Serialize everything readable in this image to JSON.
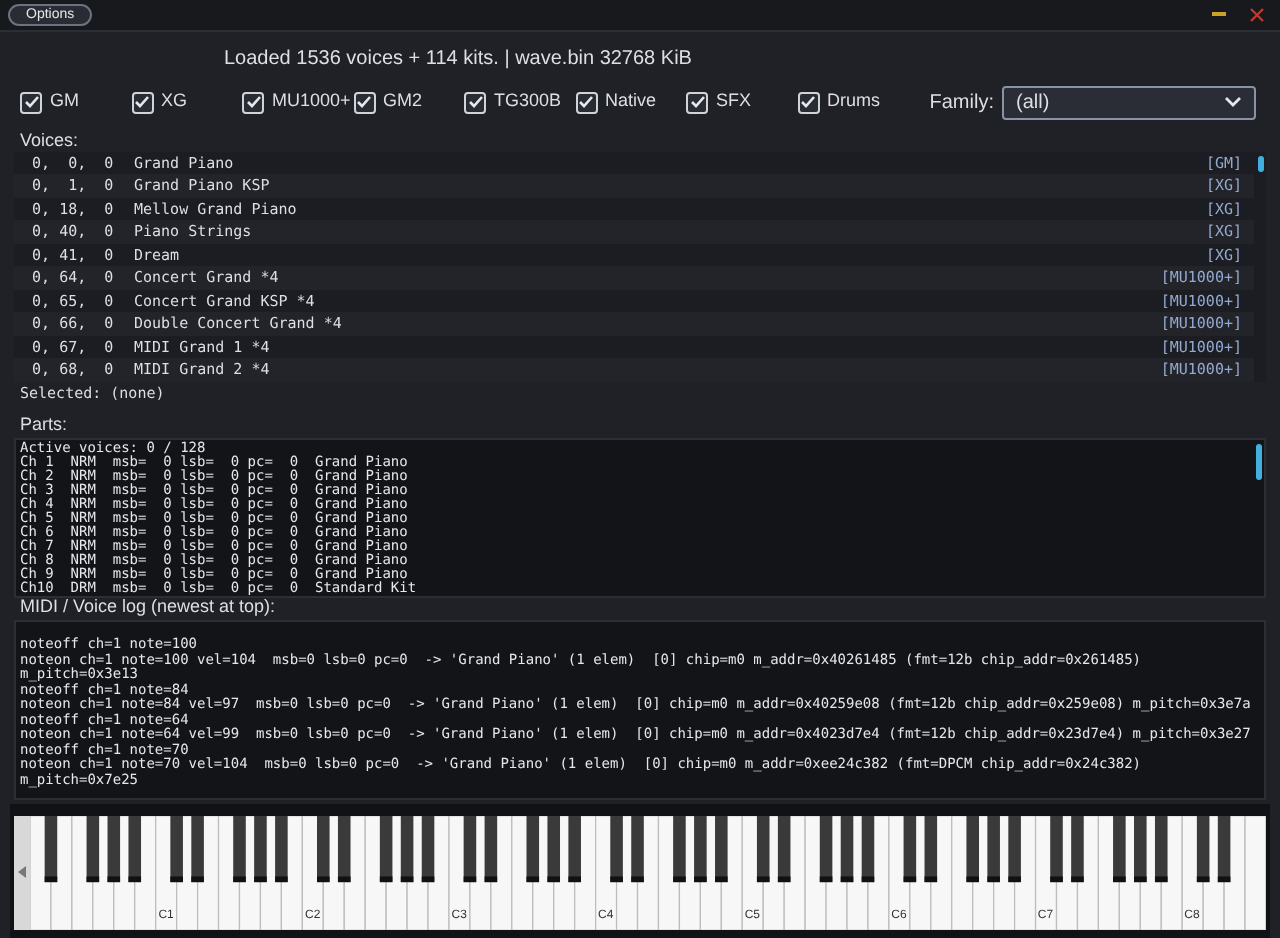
{
  "title_bar": {
    "options_button": "Options"
  },
  "status": "Loaded 1536 voices + 114 kits. | wave.bin 32768 KiB",
  "filters": [
    {
      "label": "GM",
      "checked": true
    },
    {
      "label": "XG",
      "checked": true
    },
    {
      "label": "MU1000+",
      "checked": true
    },
    {
      "label": "GM2",
      "checked": true
    },
    {
      "label": "TG300B",
      "checked": true
    },
    {
      "label": "Native",
      "checked": true
    },
    {
      "label": "SFX",
      "checked": true
    },
    {
      "label": "Drums",
      "checked": true
    }
  ],
  "family": {
    "label": "Family:",
    "value": "(all)"
  },
  "voices": {
    "label": "Voices:",
    "rows": [
      {
        "bank": "  0,  0,  0",
        "name": "Grand Piano",
        "tag": "[GM]"
      },
      {
        "bank": "  0,  1,  0",
        "name": "Grand Piano KSP",
        "tag": "[XG]"
      },
      {
        "bank": "  0, 18,  0",
        "name": "Mellow Grand Piano",
        "tag": "[XG]"
      },
      {
        "bank": "  0, 40,  0",
        "name": "Piano Strings",
        "tag": "[XG]"
      },
      {
        "bank": "  0, 41,  0",
        "name": "Dream",
        "tag": "[XG]"
      },
      {
        "bank": "  0, 64,  0",
        "name": "Concert Grand *4",
        "tag": "[MU1000+]"
      },
      {
        "bank": "  0, 65,  0",
        "name": "Concert Grand KSP *4",
        "tag": "[MU1000+]"
      },
      {
        "bank": "  0, 66,  0",
        "name": "Double Concert Grand *4",
        "tag": "[MU1000+]"
      },
      {
        "bank": "  0, 67,  0",
        "name": "MIDI Grand 1 *4",
        "tag": "[MU1000+]"
      },
      {
        "bank": "  0, 68,  0",
        "name": "MIDI Grand 2 *4",
        "tag": "[MU1000+]"
      }
    ],
    "selected": "Selected: (none)"
  },
  "parts": {
    "label": "Parts:",
    "lines": [
      "Active voices: 0 / 128",
      "Ch 1  NRM  msb=  0 lsb=  0 pc=  0  Grand Piano",
      "Ch 2  NRM  msb=  0 lsb=  0 pc=  0  Grand Piano",
      "Ch 3  NRM  msb=  0 lsb=  0 pc=  0  Grand Piano",
      "Ch 4  NRM  msb=  0 lsb=  0 pc=  0  Grand Piano",
      "Ch 5  NRM  msb=  0 lsb=  0 pc=  0  Grand Piano",
      "Ch 6  NRM  msb=  0 lsb=  0 pc=  0  Grand Piano",
      "Ch 7  NRM  msb=  0 lsb=  0 pc=  0  Grand Piano",
      "Ch 8  NRM  msb=  0 lsb=  0 pc=  0  Grand Piano",
      "Ch 9  NRM  msb=  0 lsb=  0 pc=  0  Grand Piano",
      "Ch10  DRM  msb=  0 lsb=  0 pc=  0  Standard Kit"
    ]
  },
  "log": {
    "label": "MIDI / Voice log (newest at top):",
    "lines": [
      "noteoff ch=1 note=100",
      "noteon ch=1 note=100 vel=104  msb=0 lsb=0 pc=0  -> 'Grand Piano' (1 elem)  [0] chip=m0 m_addr=0x40261485 (fmt=12b chip_addr=0x261485)",
      "m_pitch=0x3e13",
      "noteoff ch=1 note=84",
      "noteon ch=1 note=84 vel=97  msb=0 lsb=0 pc=0  -> 'Grand Piano' (1 elem)  [0] chip=m0 m_addr=0x40259e08 (fmt=12b chip_addr=0x259e08) m_pitch=0x3e7a",
      "noteoff ch=1 note=64",
      "noteon ch=1 note=64 vel=99  msb=0 lsb=0 pc=0  -> 'Grand Piano' (1 elem)  [0] chip=m0 m_addr=0x4023d7e4 (fmt=12b chip_addr=0x23d7e4) m_pitch=0x3e27",
      "noteoff ch=1 note=70",
      "noteon ch=1 note=70 vel=104  msb=0 lsb=0 pc=0  -> 'Grand Piano' (1 elem)  [0] chip=m0 m_addr=0xee24c382 (fmt=DPCM chip_addr=0x24c382)",
      "m_pitch=0x7e25"
    ]
  },
  "keyboard": {
    "octave_labels": [
      "C1",
      "C2",
      "C3",
      "C4",
      "C5",
      "C6",
      "C7",
      "C8"
    ]
  }
}
